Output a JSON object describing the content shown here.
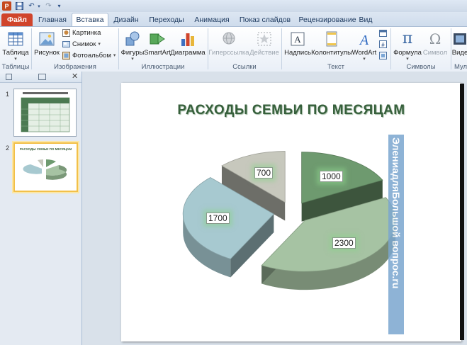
{
  "quick_access": {
    "app_icon": "P",
    "save_icon": "save-icon",
    "undo_icon": "undo-icon",
    "redo_icon": "redo-icon"
  },
  "tabs": [
    "Файл",
    "Главная",
    "Вставка",
    "Дизайн",
    "Переходы",
    "Анимация",
    "Показ слайдов",
    "Рецензирование",
    "Вид"
  ],
  "active_tab": "Вставка",
  "ribbon": {
    "table": "Таблица",
    "picture": "Рисунок",
    "clipart": "Картинка",
    "screenshot": "Снимок",
    "album": "Фотоальбом",
    "shapes": "Фигуры",
    "smartart": "SmartArt",
    "chart": "Диаграмма",
    "hyperlink": "Гиперссылка",
    "action": "Действие",
    "textbox": "Надпись",
    "headerfooter": "Колонтитулы",
    "wordart": "WordArt",
    "equation": "Формула",
    "symbol": "Символ",
    "video": "Виде",
    "groups": {
      "tables": "Таблицы",
      "images": "Изображения",
      "illustrations": "Иллюстрации",
      "links": "Ссылки",
      "text": "Текст",
      "symbols": "Символы",
      "media": "Муль"
    }
  },
  "slides_pane": {
    "numbers": [
      "1",
      "2"
    ],
    "thumb2_title": "РАСХОДЫ СЕМЬИ ПО МЕСЯЦАМ"
  },
  "slide": {
    "title": "РАСХОДЫ СЕМЬИ ПО МЕСЯЦАМ",
    "watermark": "ЭлениадляБольшой вопрос.ru"
  },
  "chart_data": {
    "type": "pie",
    "categories": [],
    "values": [
      700,
      1000,
      2300,
      1700
    ],
    "labels": [
      "700",
      "1000",
      "2300",
      "1700"
    ],
    "colors": [
      "#c7c8bd",
      "#6e9a6f",
      "#a6c3a3",
      "#a7c9d0"
    ],
    "title": "",
    "legend": "none"
  }
}
